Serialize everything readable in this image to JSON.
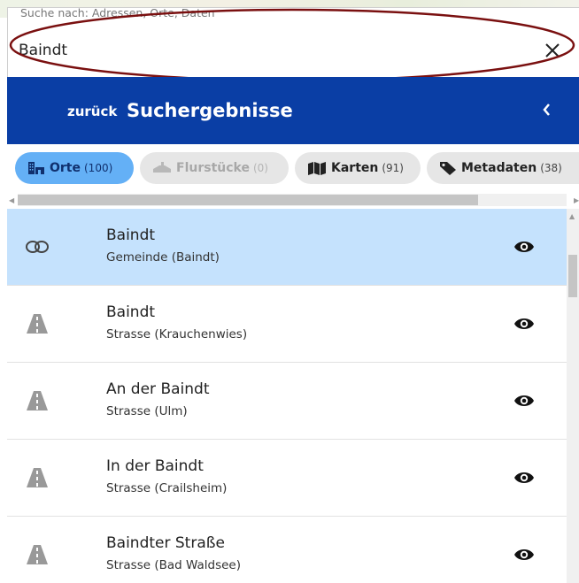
{
  "search": {
    "label": "Suche nach: Adressen, Orte, Daten",
    "value": "Baindt",
    "clear_icon": "close-icon"
  },
  "header": {
    "back_label": "zurück",
    "title": "Suchergebnisse",
    "collapse_icon": "chevron-left-icon",
    "background": "#0a3ea5"
  },
  "tabs": [
    {
      "label": "Orte",
      "count": "(100)",
      "icon": "building-icon",
      "state": "active"
    },
    {
      "label": "Flurstücke",
      "count": "(0)",
      "icon": "parcel-icon",
      "state": "disabled"
    },
    {
      "label": "Karten",
      "count": "(91)",
      "icon": "map-icon",
      "state": "normal"
    },
    {
      "label": "Metadaten",
      "count": "(38)",
      "icon": "tag-icon",
      "state": "normal"
    }
  ],
  "results": [
    {
      "title": "Baindt",
      "subtitle": "Gemeinde (Baindt)",
      "icon": "municipality-icon",
      "selected": true
    },
    {
      "title": "Baindt",
      "subtitle": "Strasse (Krauchenwies)",
      "icon": "road-icon",
      "selected": false
    },
    {
      "title": "An der Baindt",
      "subtitle": "Strasse (Ulm)",
      "icon": "road-icon",
      "selected": false
    },
    {
      "title": "In der Baindt",
      "subtitle": "Strasse (Crailsheim)",
      "icon": "road-icon",
      "selected": false
    },
    {
      "title": "Baindter Straße",
      "subtitle": "Strasse (Bad Waldsee)",
      "icon": "road-icon",
      "selected": false
    }
  ],
  "colors": {
    "accent": "#0a3ea5",
    "active_tab": "#64b0f6",
    "selected_row": "#c5e2fd",
    "annotation": "#7a1010"
  }
}
